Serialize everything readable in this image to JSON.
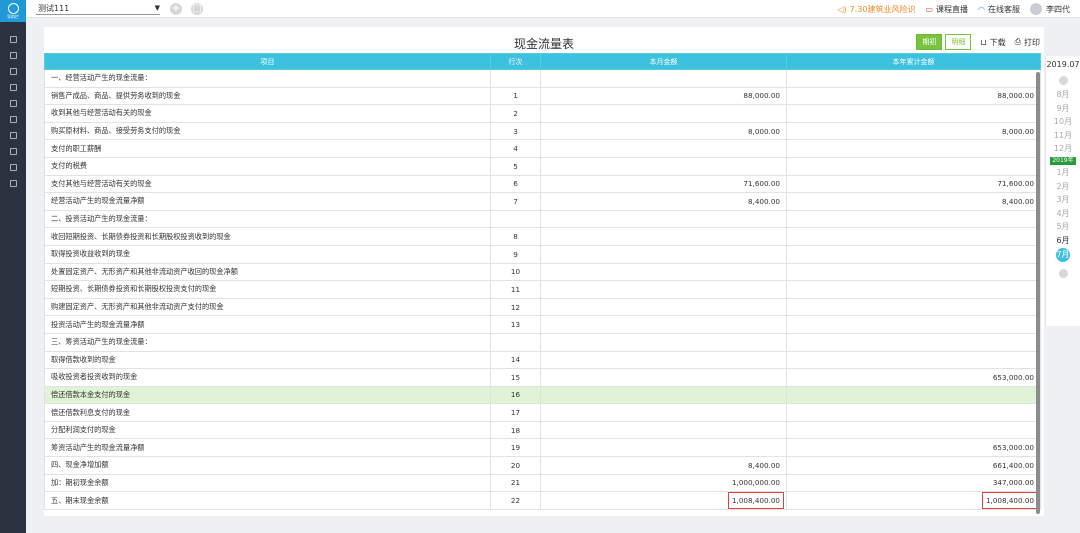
{
  "sidebar": {
    "logo_label": "导航栏",
    "item_count": 10
  },
  "topbar": {
    "company": "测试111",
    "promo": "7.30建筑业风险识",
    "course": "课程直播",
    "service": "在线客服",
    "user": "李四代"
  },
  "report": {
    "title": "现金流量表",
    "btn_period": "期初",
    "btn_detail": "明细",
    "download": "下载",
    "print": "打印"
  },
  "table": {
    "headers": [
      "项目",
      "行次",
      "本月金额",
      "本年累计金额"
    ],
    "rows": [
      {
        "item": "一、经营活动产生的现金流量：",
        "line": "",
        "month": "",
        "year": ""
      },
      {
        "item": "销售产成品、商品、提供劳务收到的现金",
        "line": "1",
        "month": "88,000.00",
        "year": "88,000.00"
      },
      {
        "item": "收到其他与经营活动有关的现金",
        "line": "2",
        "month": "",
        "year": ""
      },
      {
        "item": "购买原材料、商品、接受劳务支付的现金",
        "line": "3",
        "month": "8,000.00",
        "year": "8,000.00"
      },
      {
        "item": "支付的职工薪酬",
        "line": "4",
        "month": "",
        "year": ""
      },
      {
        "item": "支付的税费",
        "line": "5",
        "month": "",
        "year": ""
      },
      {
        "item": "支付其他与经营活动有关的现金",
        "line": "6",
        "month": "71,600.00",
        "year": "71,600.00"
      },
      {
        "item": "经营活动产生的现金流量净额",
        "line": "7",
        "month": "8,400.00",
        "year": "8,400.00"
      },
      {
        "item": "二、投资活动产生的现金流量：",
        "line": "",
        "month": "",
        "year": ""
      },
      {
        "item": "收回短期投资、长期债券投资和长期股权投资收到的现金",
        "line": "8",
        "month": "",
        "year": ""
      },
      {
        "item": "取得投资收益收到的现金",
        "line": "9",
        "month": "",
        "year": ""
      },
      {
        "item": "处置固定资产、无形资产和其他非流动资产收回的现金净额",
        "line": "10",
        "month": "",
        "year": ""
      },
      {
        "item": "短期投资、长期债券投资和长期股权投资支付的现金",
        "line": "11",
        "month": "",
        "year": ""
      },
      {
        "item": "购建固定资产、无形资产和其他非流动资产支付的现金",
        "line": "12",
        "month": "",
        "year": ""
      },
      {
        "item": "投资活动产生的现金流量净额",
        "line": "13",
        "month": "",
        "year": ""
      },
      {
        "item": "三、筹资活动产生的现金流量：",
        "line": "",
        "month": "",
        "year": ""
      },
      {
        "item": "取得借款收到的现金",
        "line": "14",
        "month": "",
        "year": ""
      },
      {
        "item": "吸收投资者投资收到的现金",
        "line": "15",
        "month": "",
        "year": "653,000.00"
      },
      {
        "item": "偿还借款本金支付的现金",
        "line": "16",
        "month": "",
        "year": ""
      },
      {
        "item": "偿还借款利息支付的现金",
        "line": "17",
        "month": "",
        "year": ""
      },
      {
        "item": "分配利润支付的现金",
        "line": "18",
        "month": "",
        "year": ""
      },
      {
        "item": "筹资活动产生的现金流量净额",
        "line": "19",
        "month": "",
        "year": "653,000.00"
      },
      {
        "item": "四、现金净增加额",
        "line": "20",
        "month": "8,400.00",
        "year": "661,400.00"
      },
      {
        "item": "加：期初现金余额",
        "line": "21",
        "month": "1,000,000.00",
        "year": "347,000.00"
      },
      {
        "item": "五、期末现金余额",
        "line": "22",
        "month": "1,008,400.00",
        "year": "1,008,400.00"
      }
    ],
    "highlight_row": 18,
    "boxed_row": 24
  },
  "period": {
    "year": "2019.07",
    "months_before": [
      "8月",
      "9月",
      "10月",
      "11月",
      "12月"
    ],
    "year_badge": "2019年",
    "months_after": [
      "1月",
      "2月",
      "3月",
      "4月",
      "5月",
      "6月"
    ],
    "current": "7月"
  },
  "colors": {
    "header": "#3cc2de",
    "highlight": "#dff3d6",
    "green": "#78c43e",
    "sidebar": "#2b3341",
    "box": "#e0403a"
  }
}
